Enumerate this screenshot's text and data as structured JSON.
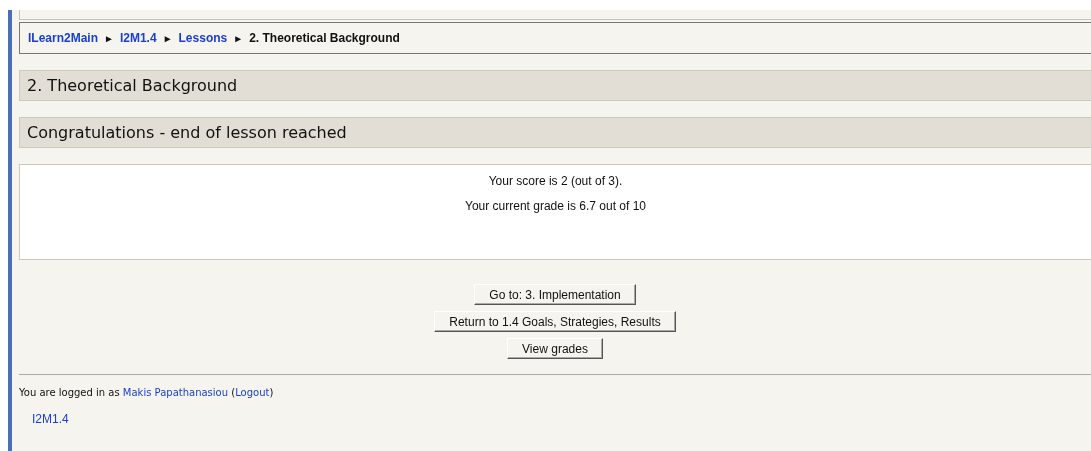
{
  "breadcrumb": [
    {
      "kind": "link",
      "text": "ILearn2Main"
    },
    {
      "kind": "sep",
      "text": "►"
    },
    {
      "kind": "link",
      "text": "I2M1.4"
    },
    {
      "kind": "sep",
      "text": "►"
    },
    {
      "kind": "link",
      "text": "Lessons"
    },
    {
      "kind": "sep",
      "text": "►"
    },
    {
      "kind": "text",
      "text": "2. Theoretical Background"
    }
  ],
  "headings": [
    "2. Theoretical Background",
    "Congratulations - end of lesson reached"
  ],
  "results": [
    "Your score is 2 (out of 3).",
    "Your current grade is 6.7 out of 10"
  ],
  "buttons": [
    "Go to: 3. Implementation",
    "Return to 1.4 Goals, Strategies, Results",
    "View grades"
  ],
  "footer": {
    "login": [
      {
        "kind": "text",
        "text": "You are logged in as "
      },
      {
        "kind": "link",
        "text": "Makis Papathanasiou"
      },
      {
        "kind": "text",
        "text": " ("
      },
      {
        "kind": "link",
        "text": "Logout"
      },
      {
        "kind": "text",
        "text": ")"
      }
    ],
    "course_link": "I2M1.4"
  }
}
